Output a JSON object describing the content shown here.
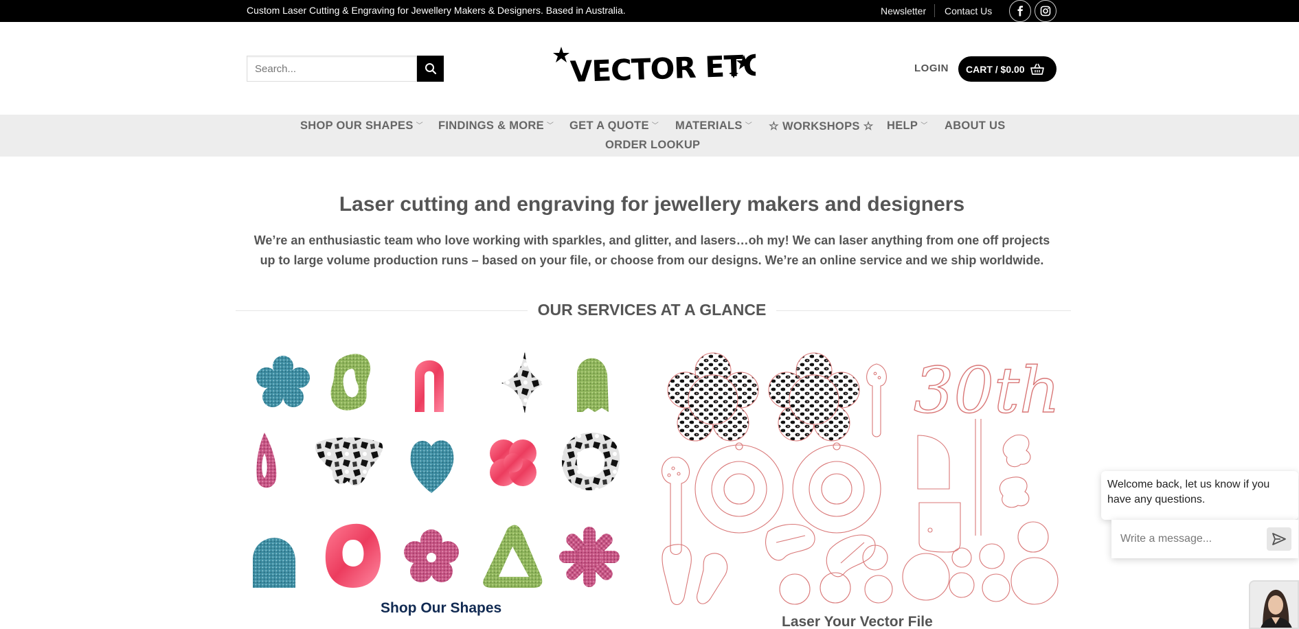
{
  "topbar": {
    "tagline": "Custom Laser Cutting & Engraving for Jewellery Makers & Designers. Based in Australia.",
    "newsletter": "Newsletter",
    "contact": "Contact Us",
    "social": [
      "facebook-icon",
      "instagram-icon"
    ]
  },
  "header": {
    "search_placeholder": "Search...",
    "logo_text": "VECTOR ETCH",
    "login": "LOGIN",
    "cart": "CART / $0.00"
  },
  "nav": {
    "items": [
      {
        "label": "SHOP OUR SHAPES",
        "has_dropdown": true
      },
      {
        "label": "FINDINGS & MORE",
        "has_dropdown": true
      },
      {
        "label": "GET A QUOTE",
        "has_dropdown": true
      },
      {
        "label": "MATERIALS",
        "has_dropdown": true
      },
      {
        "label": "☆ WORKSHOPS ☆",
        "has_dropdown": false
      },
      {
        "label": "HELP",
        "has_dropdown": true
      },
      {
        "label": "ABOUT US",
        "has_dropdown": false
      },
      {
        "label": "ORDER LOOKUP",
        "has_dropdown": false
      }
    ]
  },
  "main": {
    "title": "Laser cutting and engraving for jewellery makers and designers",
    "intro": "We’re an enthusiastic team who love working with sparkles, and glitter, and lasers…oh my! We can laser anything from one off projects up to large volume production runs – based on your file, or choose from our designs. We’re an online service and we ship worldwide.",
    "section_title": "OUR SERVICES AT A GLANCE",
    "services": [
      {
        "label": "Shop Our Shapes"
      },
      {
        "label": "Laser Your Vector File"
      }
    ]
  },
  "chat": {
    "welcome": "Welcome back, let us know if you have any questions.",
    "input_placeholder": "Write a message..."
  },
  "colors": {
    "topbar_bg": "#000000",
    "nav_bg": "#ededed",
    "service_label": "#112a52",
    "glitter_blue": "#3f8ea3",
    "glitter_green": "#8fb55c",
    "pink_marble": "#f04a6a",
    "glitter_pink": "#c75685",
    "cut_line": "#d97777"
  }
}
